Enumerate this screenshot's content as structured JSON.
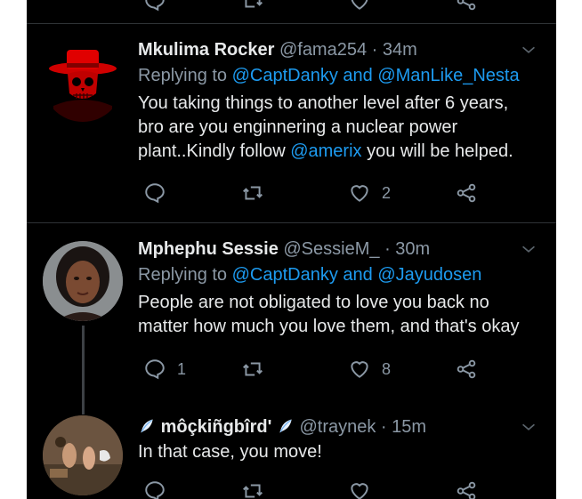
{
  "tweets": [
    {
      "name": "Mkulima Rocker",
      "handle": "@fama254",
      "time": "34m",
      "reply_prefix": "Replying to ",
      "reply_mentions": "@CaptDanky and @ManLike_Nesta",
      "body_1": "You taking things to another level after 6 years,\nbro are you enginnering a nuclear power\nplant..Kindly follow ",
      "body_mention": "@amerix",
      "body_2": " you will be helped.",
      "likes": "2",
      "replies": ""
    },
    {
      "name": "Mphephu Sessie",
      "handle": "@SessieM_",
      "time": "30m",
      "reply_prefix": "Replying to ",
      "reply_mentions": "@CaptDanky and @Jayudosen",
      "body": "People are not obligated to love you back no\nmatter how much you love them, and that's okay",
      "replies": "1",
      "likes": "8"
    },
    {
      "name": "môçkiñgbîrd'",
      "handle": "@traynek",
      "time": "15m",
      "body": "In that case, you move!"
    }
  ],
  "separator": "·",
  "colors": {
    "background": "#000000",
    "text": "#e7e9ea",
    "muted": "#8b98a5",
    "link": "#1d9bf0",
    "divider": "#2f3336"
  },
  "icons": [
    "reply-icon",
    "retweet-icon",
    "like-icon",
    "share-icon",
    "chevron-down-icon",
    "feather-icon"
  ]
}
